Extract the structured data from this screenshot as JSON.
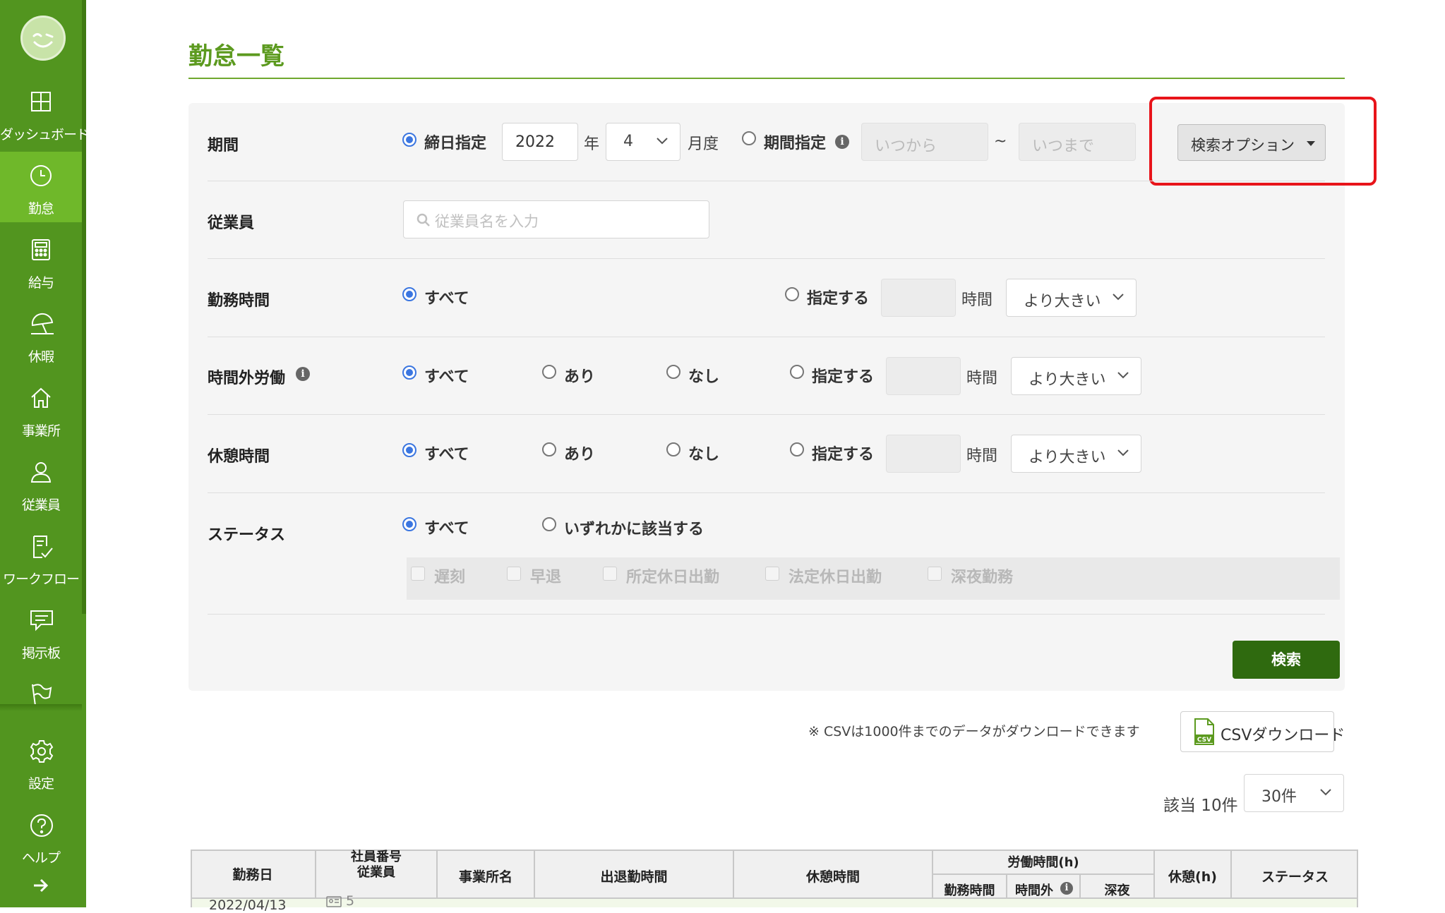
{
  "sidebar": {
    "items": [
      {
        "label": "ダッシュボード",
        "icon": "dashboard-icon"
      },
      {
        "label": "勤怠",
        "icon": "clock-icon",
        "active": true
      },
      {
        "label": "給与",
        "icon": "calculator-icon"
      },
      {
        "label": "休暇",
        "icon": "umbrella-icon"
      },
      {
        "label": "事業所",
        "icon": "home-icon"
      },
      {
        "label": "従業員",
        "icon": "person-icon"
      },
      {
        "label": "ワークフロー",
        "icon": "checklist-icon"
      },
      {
        "label": "掲示板",
        "icon": "message-icon"
      },
      {
        "label": "",
        "icon": "flag-icon"
      },
      {
        "label": "設定",
        "icon": "gear-icon"
      },
      {
        "label": "ヘルプ",
        "icon": "help-icon"
      },
      {
        "label": "",
        "icon": "arrow-right-icon"
      }
    ],
    "colors": {
      "bg": "#52951f",
      "active": "#6fb82a"
    }
  },
  "page": {
    "title": "勤怠一覧"
  },
  "filters": {
    "period": {
      "label": "期間",
      "cutoff_label": "締日指定",
      "year_value": "2022",
      "year_suffix": "年",
      "month_value": "4",
      "month_suffix": "月度",
      "range_label": "期間指定",
      "from_placeholder": "いつから",
      "tilde": "~",
      "to_placeholder": "いつまで"
    },
    "search_options_button": "検索オプション",
    "employee": {
      "label": "従業員",
      "placeholder": "従業員名を入力"
    },
    "work_time": {
      "label": "勤務時間",
      "all": "すべて",
      "specify": "指定する",
      "unit": "時間",
      "compare": "より大きい"
    },
    "overtime": {
      "label": "時間外労働",
      "all": "すべて",
      "yes": "あり",
      "no": "なし",
      "specify": "指定する",
      "unit": "時間",
      "compare": "より大きい"
    },
    "break_time": {
      "label": "休憩時間",
      "all": "すべて",
      "yes": "あり",
      "no": "なし",
      "specify": "指定する",
      "unit": "時間",
      "compare": "より大きい"
    },
    "status": {
      "label": "ステータス",
      "all": "すべて",
      "any": "いずれかに該当する",
      "options": [
        "遅刻",
        "早退",
        "所定休日出勤",
        "法定休日出勤",
        "深夜勤務"
      ]
    },
    "search_button": "検索"
  },
  "csv": {
    "note": "※ CSVは1000件までのデータがダウンロードできます",
    "button": "CSVダウンロード",
    "icon_text": "CSV"
  },
  "results": {
    "count_label": "該当 10件",
    "per_page": "30件"
  },
  "table": {
    "headers": {
      "work_date": "勤務日",
      "emp_no": "社員番号",
      "employee": "従業員",
      "office": "事業所名",
      "clock": "出退勤時間",
      "break": "休憩時間",
      "labor_group": "労働時間(h)",
      "labor_work": "勤務時間",
      "labor_overtime": "時間外",
      "labor_night": "深夜",
      "break_h": "休憩(h)",
      "status": "ステータス"
    },
    "rows": [
      {
        "work_date": "2022/04/13",
        "emp_no": "5"
      }
    ]
  },
  "colors": {
    "title": "#5c9a1f",
    "primary_button": "#2f6a0f",
    "radio": "#3b76e0",
    "highlight": "#e8141a"
  }
}
